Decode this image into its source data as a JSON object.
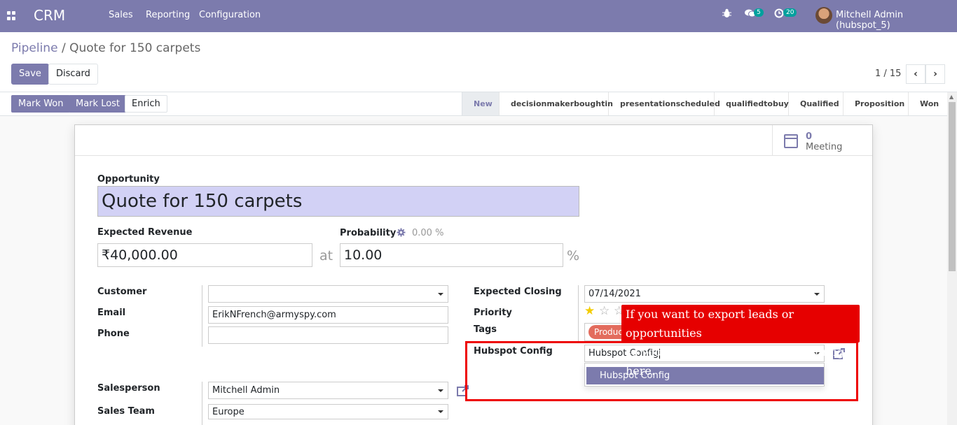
{
  "topbar": {
    "app_name": "CRM",
    "menus": [
      "Sales",
      "Reporting",
      "Configuration"
    ],
    "messages_count": "5",
    "activities_count": "20",
    "user_name": "Mitchell Admin (hubspot_5)",
    "colors": {
      "brand": "#7c7bad",
      "badge": "#00a09d"
    }
  },
  "breadcrumb": {
    "parent": "Pipeline",
    "separator": "/",
    "current": "Quote for 150 carpets"
  },
  "toolbar": {
    "save_label": "Save",
    "discard_label": "Discard"
  },
  "pager": {
    "value": "1 / 15"
  },
  "actions": {
    "mark_won": "Mark Won",
    "mark_lost": "Mark Lost",
    "enrich": "Enrich"
  },
  "stages": [
    "New",
    "decisionmakerboughtin",
    "presentationscheduled",
    "qualifiedtobuy",
    "Qualified",
    "Proposition",
    "Won"
  ],
  "active_stage": "New",
  "smart_button": {
    "count": "0",
    "label": "Meeting"
  },
  "form": {
    "opportunity_label": "Opportunity",
    "opportunity_value": "Quote for 150 carpets",
    "expected_revenue_label": "Expected Revenue",
    "expected_revenue_value": "₹40,000.00",
    "at_text": "at",
    "probability_label": "Probability",
    "probability_auto": "0.00 %",
    "probability_value": "10.00",
    "percent_sign": "%",
    "customer_label": "Customer",
    "customer_value": "",
    "email_label": "Email",
    "email_value": "ErikNFrench@armyspy.com",
    "phone_label": "Phone",
    "phone_value": "",
    "expected_closing_label": "Expected Closing",
    "expected_closing_value": "07/14/2021",
    "priority_label": "Priority",
    "priority_stars": 1,
    "priority_max": 3,
    "tags_label": "Tags",
    "tag_value": "Product",
    "hubspot_config_label": "Hubspot Config",
    "hubspot_config_value": "Hubspot Config",
    "hubspot_dropdown_option": "Hubspot Config",
    "salesperson_label": "Salesperson",
    "salesperson_value": "Mitchell Admin",
    "sales_team_label": "Sales Team",
    "sales_team_value": "Europe"
  },
  "callout": {
    "line1": "If you want to export leads or opportunities",
    "line2": "so you have to define a hubspot config here."
  },
  "icons": [
    "apps-grid-icon",
    "bug-icon",
    "chat-icon",
    "clock-icon",
    "calendar-icon",
    "gear-icon",
    "star-icon",
    "external-link-icon",
    "chevron-left-icon",
    "chevron-right-icon"
  ]
}
